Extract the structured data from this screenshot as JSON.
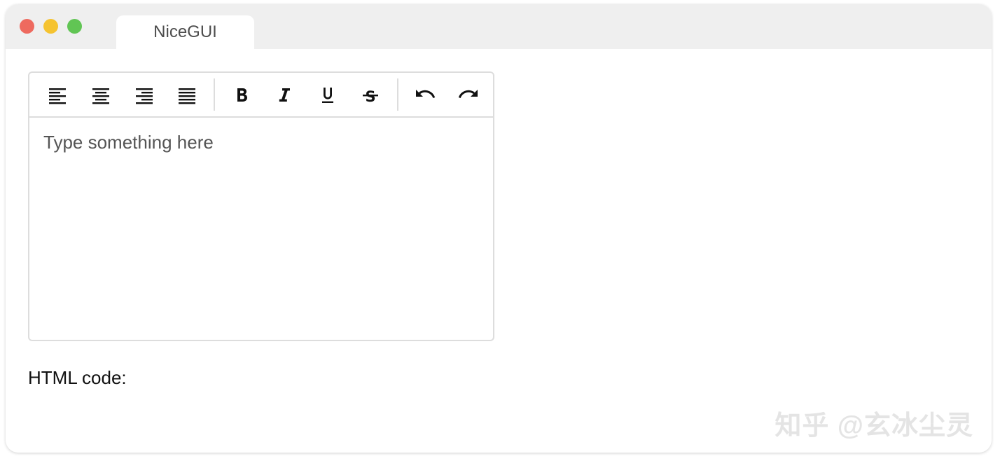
{
  "window": {
    "traffic_lights": {
      "close_color": "#ee6a5f",
      "minimize_color": "#f5c330",
      "maximize_color": "#61c554"
    },
    "tab_title": "NiceGUI"
  },
  "editor": {
    "toolbar": {
      "alignment": [
        {
          "name": "align-left",
          "icon": "align-left-icon"
        },
        {
          "name": "align-center",
          "icon": "align-center-icon"
        },
        {
          "name": "align-right",
          "icon": "align-right-icon"
        },
        {
          "name": "align-justify",
          "icon": "align-justify-icon"
        }
      ],
      "format": [
        {
          "name": "bold",
          "icon": "bold-icon"
        },
        {
          "name": "italic",
          "icon": "italic-icon"
        },
        {
          "name": "underline",
          "icon": "underline-icon"
        },
        {
          "name": "strikethrough",
          "icon": "strikethrough-icon"
        }
      ],
      "history": [
        {
          "name": "undo",
          "icon": "undo-icon"
        },
        {
          "name": "redo",
          "icon": "redo-icon"
        }
      ]
    },
    "placeholder": "Type something here"
  },
  "html_code_label": "HTML code:",
  "watermark": "知乎 @玄冰尘灵"
}
